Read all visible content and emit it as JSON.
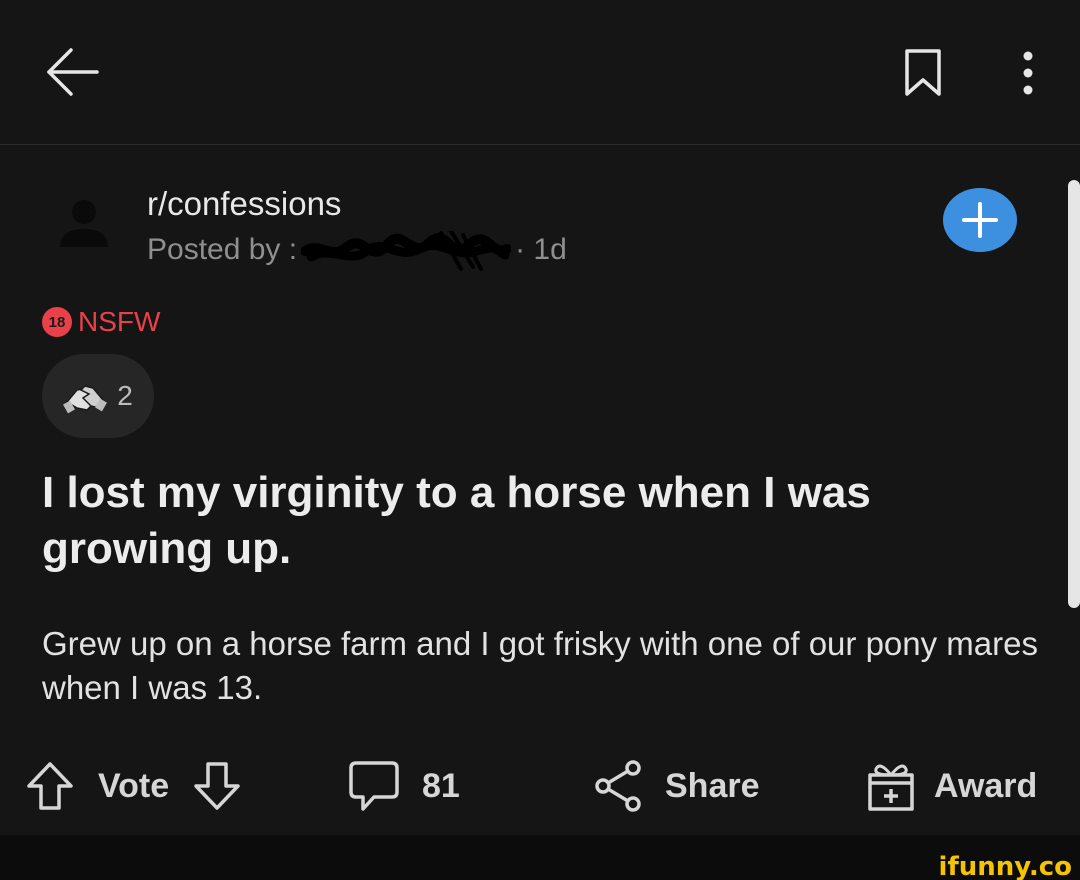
{
  "post": {
    "subreddit": "r/confessions",
    "posted_by_prefix": "Posted by",
    "age": "· 1d",
    "nsfw_label": "NSFW",
    "nsfw_badge": "18",
    "award_count": "2",
    "title": "I lost my virginity to a horse when I was growing up.",
    "body": "Grew up on a horse farm and I got frisky with one of our pony mares when I was 13."
  },
  "actions": {
    "vote_label": "Vote",
    "comments_count": "81",
    "share_label": "Share",
    "award_label": "Award"
  },
  "icons": {
    "back": "back-arrow-icon",
    "bookmark": "bookmark-icon",
    "more": "more-vertical-icon",
    "avatar": "user-avatar-icon",
    "join": "plus-icon",
    "award_badge": "handshake-award-icon",
    "upvote": "upvote-arrow-icon",
    "downvote": "downvote-arrow-icon",
    "comment": "comment-bubble-icon",
    "share": "share-icon",
    "award": "gift-icon"
  },
  "colors": {
    "background": "#151515",
    "nsfw": "#e8414a",
    "join_button": "#3d8fe0",
    "watermark": "#f5c400"
  },
  "watermark": "ifunny.co"
}
